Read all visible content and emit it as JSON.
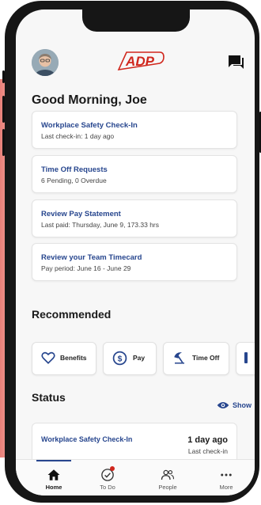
{
  "header": {
    "logo_text": "ADP"
  },
  "greeting": "Good Morning, Joe",
  "cards": [
    {
      "title": "Workplace Safety Check-In",
      "subtitle": "Last check-in: 1 day ago"
    },
    {
      "title": "Time Off Requests",
      "subtitle": "6 Pending, 0 Overdue"
    },
    {
      "title": "Review Pay Statement",
      "subtitle": "Last paid: Thursday, June 9, 173.33 hrs"
    },
    {
      "title": "Review your Team Timecard",
      "subtitle": "Pay period: June 16 - June 29"
    }
  ],
  "recommended": {
    "heading": "Recommended",
    "items": [
      {
        "label": "Benefits",
        "icon": "heart-icon"
      },
      {
        "label": "Pay",
        "icon": "dollar-icon"
      },
      {
        "label": "Time Off",
        "icon": "beach-umbrella-icon"
      }
    ]
  },
  "status": {
    "heading": "Status",
    "show_label": "Show",
    "card": {
      "title": "Workplace Safety Check-In",
      "value": "1 day ago",
      "label": "Last check-in"
    }
  },
  "tabbar": {
    "tabs": [
      {
        "label": "Home",
        "icon": "home-icon",
        "active": true
      },
      {
        "label": "To Do",
        "icon": "todo-check-icon"
      },
      {
        "label": "People",
        "icon": "people-icon"
      },
      {
        "label": "More",
        "icon": "more-dots-icon"
      }
    ]
  },
  "colors": {
    "brand_red": "#d0271d",
    "link_blue": "#27468e",
    "background": "#f7f7f7"
  }
}
